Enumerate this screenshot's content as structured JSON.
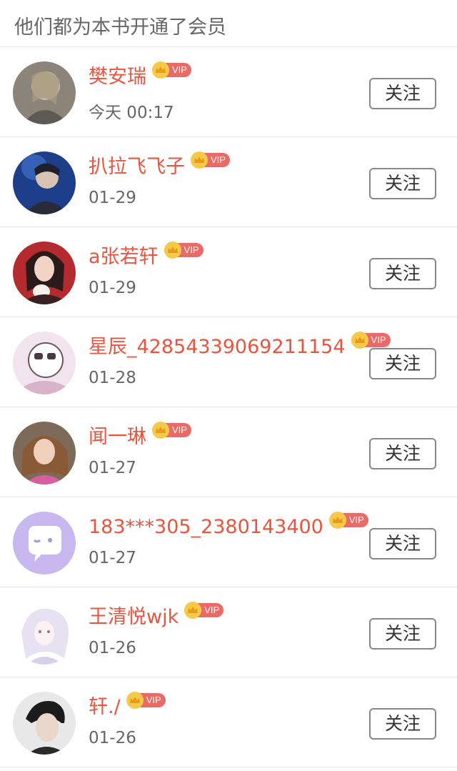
{
  "header": {
    "title": "他们都为本书开通了会员"
  },
  "vip_label": "VIP",
  "follow_label": "关注",
  "colors": {
    "name": "#e8553f",
    "vip_crown": "#f7c948",
    "vip_tag": "#e96a66",
    "divider": "#e6e6e6"
  },
  "members": [
    {
      "name": "樊安瑞",
      "date": "今天 00:17"
    },
    {
      "name": "扒拉飞飞子",
      "date": "01-29"
    },
    {
      "name": "a张若轩",
      "date": "01-29"
    },
    {
      "name": "星辰_42854339069211154",
      "date": "01-28"
    },
    {
      "name": "闻一琳",
      "date": "01-27"
    },
    {
      "name": "183***305_2380143400",
      "date": "01-27"
    },
    {
      "name": "王清悦wjk",
      "date": "01-26"
    },
    {
      "name": "轩./",
      "date": "01-26"
    }
  ]
}
